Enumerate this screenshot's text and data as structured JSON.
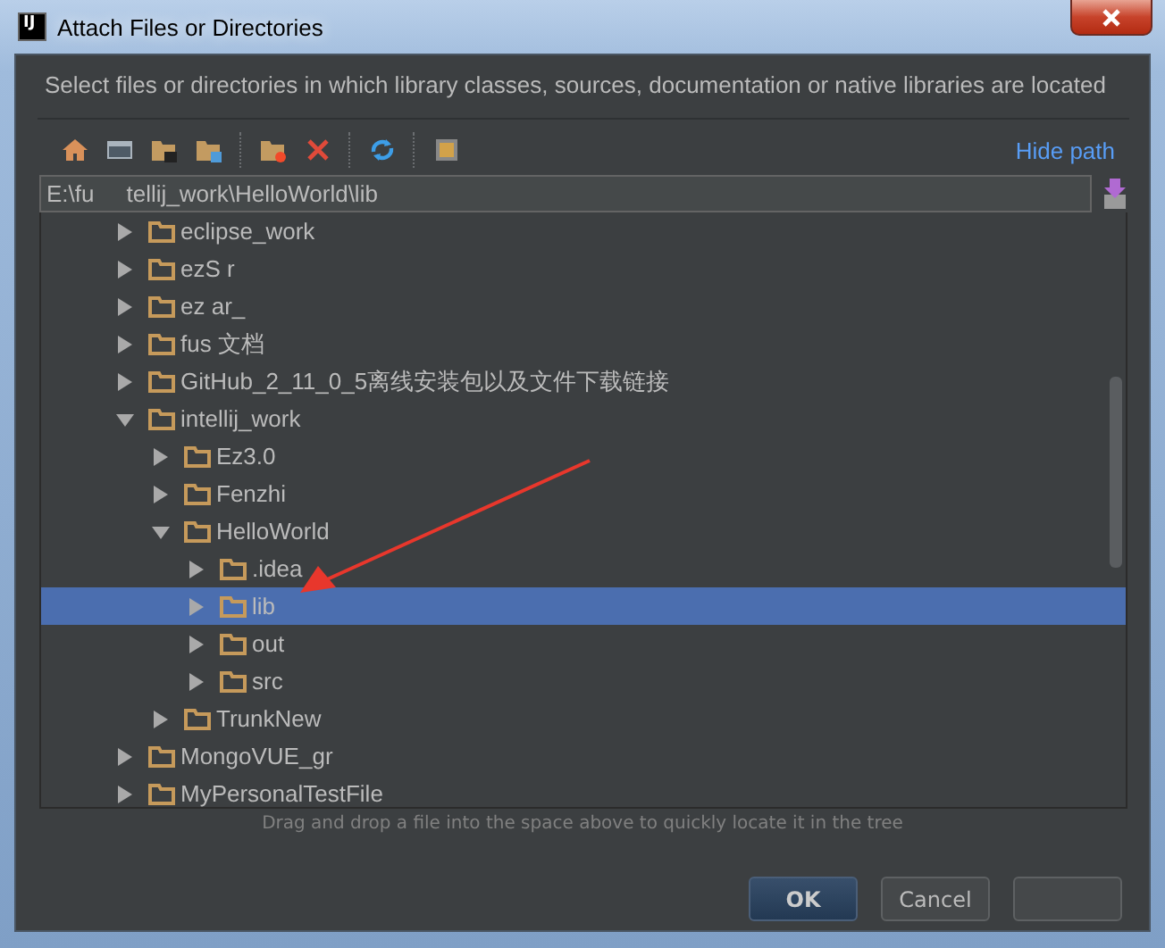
{
  "window": {
    "title": "Attach Files or Directories",
    "app_icon_text": "IJ"
  },
  "description": "Select files or directories in which library classes, sources, documentation or native libraries are located",
  "hide_path_link": "Hide path",
  "path_field": {
    "value": "E:\\fu     tellij_work\\HelloWorld\\lib"
  },
  "tree": [
    {
      "name": "eclipse_work",
      "expanded": false,
      "selected": false
    },
    {
      "name": "ezS     r",
      "expanded": false,
      "selected": false
    },
    {
      "name": "ez     ar_",
      "expanded": false,
      "selected": false
    },
    {
      "name": "fus     文档",
      "expanded": false,
      "selected": false
    },
    {
      "name": "GitHub_2_11_0_5离线安装包以及文件下载链接",
      "expanded": false,
      "selected": false
    },
    {
      "name": "intellij_work",
      "expanded": true,
      "selected": false,
      "children": [
        {
          "name": "Ez3.0",
          "expanded": false,
          "selected": false
        },
        {
          "name": "Fenzhi",
          "expanded": false,
          "selected": false
        },
        {
          "name": "HelloWorld",
          "expanded": true,
          "selected": false,
          "children": [
            {
              "name": ".idea",
              "expanded": false,
              "selected": false
            },
            {
              "name": "lib",
              "expanded": false,
              "selected": true
            },
            {
              "name": "out",
              "expanded": false,
              "selected": false
            },
            {
              "name": "src",
              "expanded": false,
              "selected": false
            }
          ]
        },
        {
          "name": "TrunkNew",
          "expanded": false,
          "selected": false
        }
      ]
    },
    {
      "name": "MongoVUE_gr",
      "expanded": false,
      "selected": false
    },
    {
      "name": "MyPersonalTestFile",
      "expanded": false,
      "selected": false
    }
  ],
  "hint": "Drag and drop a file into the space above to quickly locate it in the tree",
  "buttons": [
    {
      "label": "OK",
      "kind": "default"
    },
    {
      "label": "Cancel",
      "kind": "normal"
    },
    {
      "kind": "normal"
    }
  ]
}
